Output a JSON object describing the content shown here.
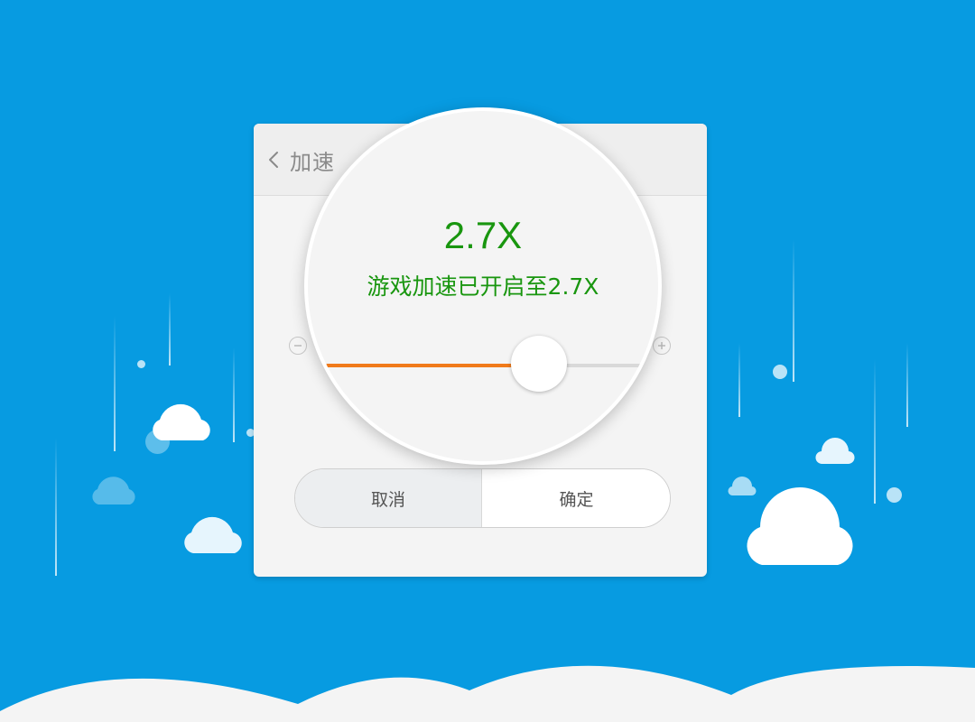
{
  "dialog": {
    "title": "加速",
    "back_icon": "chevron-left-icon",
    "speed_value": "2.7X",
    "speed_message": "游戏加速已开启至2.7X",
    "slider": {
      "value_fraction": 0.675,
      "decrease_icon": "minus-circle-icon",
      "increase_icon": "plus-circle-icon"
    },
    "cancel_label": "取消",
    "confirm_label": "确定"
  },
  "colors": {
    "background": "#079be1",
    "accent_green": "#19960f",
    "slider_fill": "#f07a1a"
  }
}
